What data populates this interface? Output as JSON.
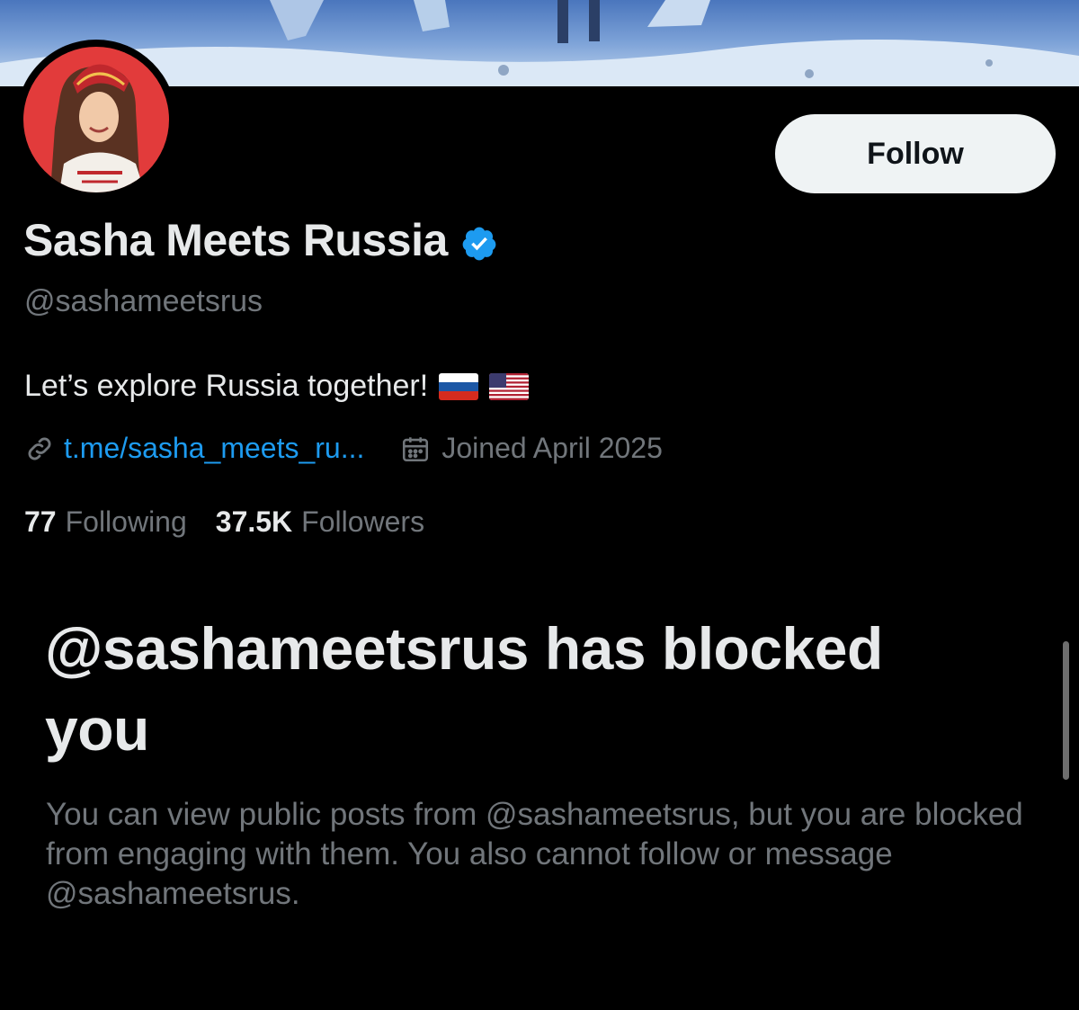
{
  "profile": {
    "display_name": "Sasha Meets Russia",
    "handle": "@sashameetsrus",
    "bio": "Let’s explore Russia together!",
    "bio_flags": [
      "flag-russia-icon",
      "flag-usa-icon"
    ],
    "link": "t.me/sasha_meets_ru...",
    "joined": "Joined April 2025",
    "following_count": "77",
    "following_label": "Following",
    "followers_count": "37.5K",
    "followers_label": "Followers",
    "verified": true
  },
  "actions": {
    "follow_label": "Follow"
  },
  "blocked": {
    "title": "@sashameetsrus has blocked you",
    "body": "You can view public posts from @sashameetsrus, but you are blocked from engaging with them. You also cannot follow or message @sashameetsrus."
  },
  "colors": {
    "background": "#000000",
    "text_primary": "#e7e9ea",
    "text_secondary": "#71767b",
    "link": "#1d9bf0",
    "verified": "#1d9bf0",
    "follow_button_bg": "#eff3f4",
    "avatar_bg": "#e23b3b"
  }
}
